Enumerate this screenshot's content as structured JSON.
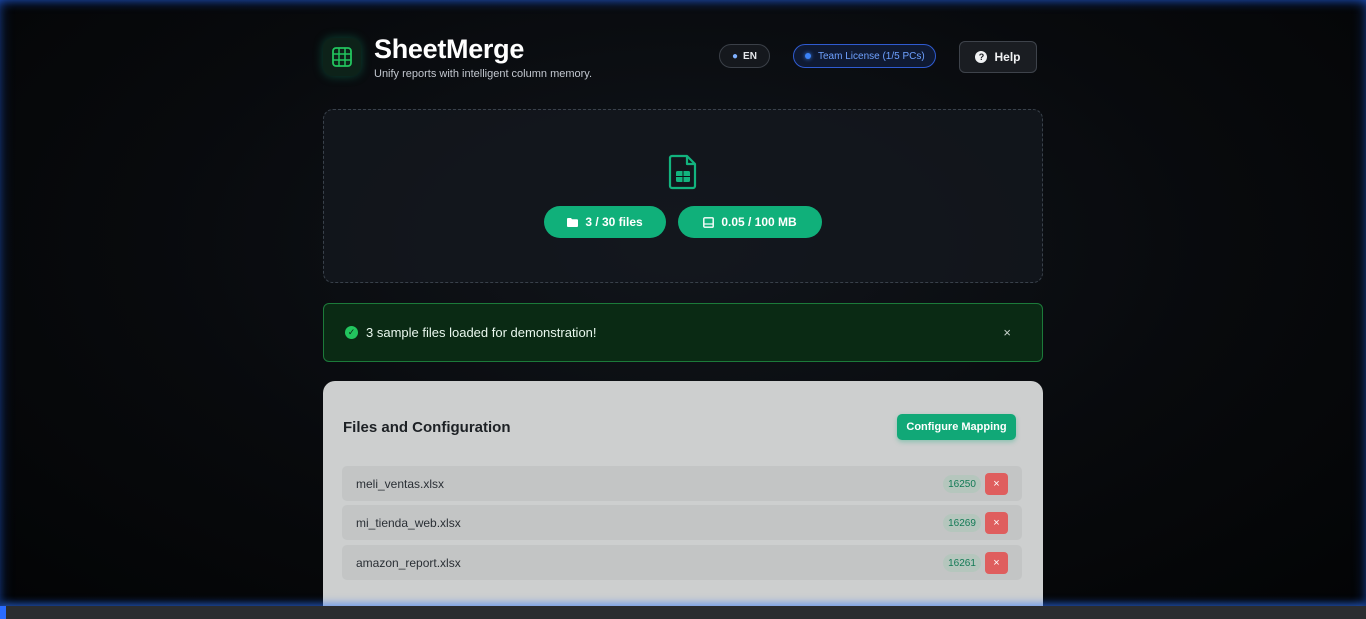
{
  "app": {
    "title": "SheetMerge",
    "subtitle": "Unify reports with intelligent column memory."
  },
  "header": {
    "language": "EN",
    "license": "Team License (1/5 PCs)",
    "help_label": "Help"
  },
  "dropzone": {
    "files_stat": "3 / 30 files",
    "size_stat": "0.05 / 100 MB"
  },
  "alert": {
    "message": "3 sample files loaded for demonstration!",
    "close_symbol": "×"
  },
  "config_card": {
    "title": "Files and Configuration",
    "configure_button": "Configure Mapping",
    "files": [
      {
        "name": "meli_ventas.xlsx",
        "count": "16250",
        "remove_symbol": "×"
      },
      {
        "name": "mi_tienda_web.xlsx",
        "count": "16269",
        "remove_symbol": "×"
      },
      {
        "name": "amazon_report.xlsx",
        "count": "16261",
        "remove_symbol": "×"
      }
    ]
  },
  "colors": {
    "accent_green": "#10b07a",
    "license_blue": "#3b82f6",
    "alert_bg": "#0a2a14",
    "danger_red": "#df5e5e"
  },
  "icons": {
    "logo": "spreadsheet-grid-icon",
    "language": "globe-icon",
    "help": "question-circle-icon",
    "upload": "file-spreadsheet-icon",
    "files_stat": "folder-icon",
    "size_stat": "hard-drive-icon",
    "alert": "check-circle-icon"
  }
}
